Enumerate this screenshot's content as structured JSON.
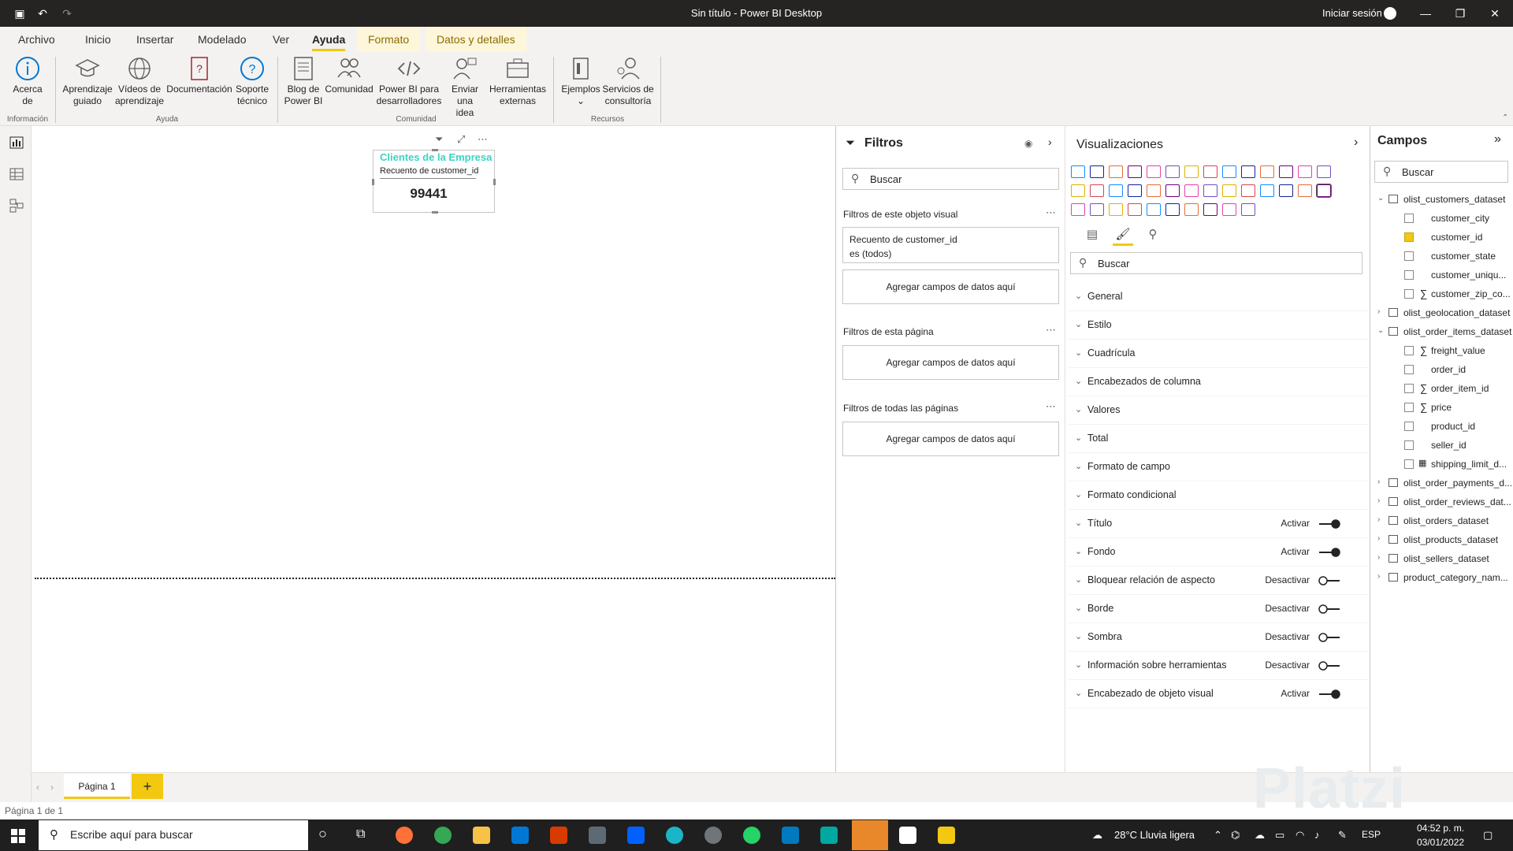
{
  "window": {
    "title": "Sin título - Power BI Desktop",
    "signin": "Iniciar sesión"
  },
  "menu_tabs": [
    "Archivo",
    "Inicio",
    "Insertar",
    "Modelado",
    "Ver",
    "Ayuda",
    "Formato",
    "Datos y detalles"
  ],
  "ribbon": {
    "buttons": [
      {
        "label": "Acerca\nde"
      },
      {
        "label": "Aprendizaje\nguiado"
      },
      {
        "label": "Vídeos de\naprendizaje"
      },
      {
        "label": "Documentación"
      },
      {
        "label": "Soporte\ntécnico"
      },
      {
        "label": "Blog de\nPower BI"
      },
      {
        "label": "Comunidad"
      },
      {
        "label": "Power BI para\ndesarrolladores"
      },
      {
        "label": "Enviar una\nidea"
      },
      {
        "label": "Herramientas\nexternas"
      },
      {
        "label": "Ejemplos\n⌄"
      },
      {
        "label": "Servicios de\nconsultoría"
      }
    ],
    "groups": [
      "Información",
      "Ayuda",
      "Comunidad",
      "Recursos"
    ]
  },
  "card": {
    "title": "Clientes de la Empresa",
    "subtitle": "Recuento de customer_id",
    "value": "99441"
  },
  "filters": {
    "title": "Filtros",
    "search_placeholder": "Buscar",
    "visual_section": "Filtros de este objeto visual",
    "visual_filter_line1": "Recuento de customer_id",
    "visual_filter_line2": "es (todos)",
    "add_fields": "Agregar campos de datos aquí",
    "page_section": "Filtros de esta página",
    "all_pages_section": "Filtros de todas las páginas"
  },
  "visualizations": {
    "title": "Visualizaciones",
    "search_placeholder": "Buscar",
    "sections": [
      {
        "label": "General",
        "toggle": ""
      },
      {
        "label": "Estilo",
        "toggle": ""
      },
      {
        "label": "Cuadrícula",
        "toggle": ""
      },
      {
        "label": "Encabezados de columna",
        "toggle": ""
      },
      {
        "label": "Valores",
        "toggle": ""
      },
      {
        "label": "Total",
        "toggle": ""
      },
      {
        "label": "Formato de campo",
        "toggle": ""
      },
      {
        "label": "Formato condicional",
        "toggle": ""
      },
      {
        "label": "Título",
        "toggle": "Activar"
      },
      {
        "label": "Fondo",
        "toggle": "Activar"
      },
      {
        "label": "Bloquear relación de aspecto",
        "toggle": "Desactivar"
      },
      {
        "label": "Borde",
        "toggle": "Desactivar"
      },
      {
        "label": "Sombra",
        "toggle": "Desactivar"
      },
      {
        "label": "Información sobre herramientas",
        "toggle": "Desactivar"
      },
      {
        "label": "Encabezado de objeto visual",
        "toggle": "Activar"
      }
    ]
  },
  "fields": {
    "title": "Campos",
    "search_placeholder": "Buscar",
    "tables": [
      {
        "name": "olist_customers_dataset",
        "expanded": true,
        "columns": [
          {
            "name": "customer_city",
            "sigma": false,
            "checked": false
          },
          {
            "name": "customer_id",
            "sigma": false,
            "checked": true
          },
          {
            "name": "customer_state",
            "sigma": false,
            "checked": false
          },
          {
            "name": "customer_uniqu...",
            "sigma": false,
            "checked": false
          },
          {
            "name": "customer_zip_co...",
            "sigma": true,
            "checked": false
          }
        ]
      },
      {
        "name": "olist_geolocation_dataset",
        "expanded": false,
        "columns": []
      },
      {
        "name": "olist_order_items_dataset",
        "expanded": true,
        "columns": [
          {
            "name": "freight_value",
            "sigma": true,
            "checked": false
          },
          {
            "name": "order_id",
            "sigma": false,
            "checked": false
          },
          {
            "name": "order_item_id",
            "sigma": true,
            "checked": false
          },
          {
            "name": "price",
            "sigma": true,
            "checked": false
          },
          {
            "name": "product_id",
            "sigma": false,
            "checked": false
          },
          {
            "name": "seller_id",
            "sigma": false,
            "checked": false
          },
          {
            "name": "shipping_limit_d...",
            "sigma": false,
            "checked": false
          }
        ]
      },
      {
        "name": "olist_order_payments_d...",
        "expanded": false,
        "columns": []
      },
      {
        "name": "olist_order_reviews_dat...",
        "expanded": false,
        "columns": []
      },
      {
        "name": "olist_orders_dataset",
        "expanded": false,
        "columns": []
      },
      {
        "name": "olist_products_dataset",
        "expanded": false,
        "columns": []
      },
      {
        "name": "olist_sellers_dataset",
        "expanded": false,
        "columns": []
      },
      {
        "name": "product_category_nam...",
        "expanded": false,
        "columns": []
      }
    ]
  },
  "page_tab": "Página 1",
  "status_bar": "Página 1 de 1",
  "taskbar": {
    "search_placeholder": "Escribe aquí para buscar",
    "weather": "28°C  Lluvia ligera",
    "lang": "ESP",
    "time": "04:52 p. m.",
    "date": "03/01/2022"
  },
  "watermark": "Platzi",
  "colors": {
    "accent": "#f2c811",
    "card_title": "#3cd3c4",
    "titlebar": "#252423"
  }
}
